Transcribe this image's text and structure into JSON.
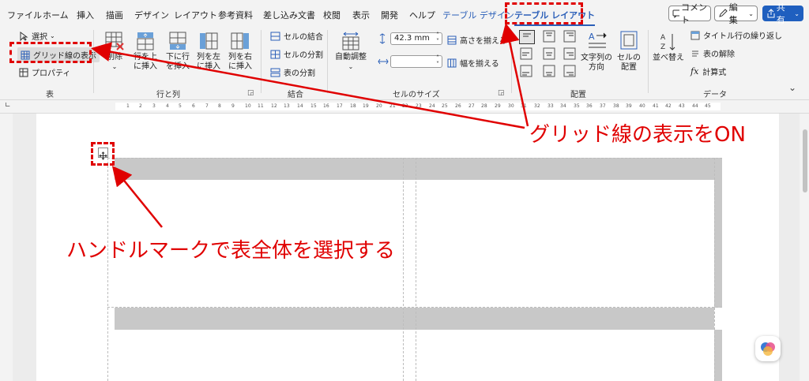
{
  "tabs": [
    "ファイル",
    "ホーム",
    "挿入",
    "描画",
    "デザイン",
    "レイアウト",
    "参考資料",
    "差し込み文書",
    "校閲",
    "表示",
    "開発",
    "ヘルプ",
    "テーブル デザイン",
    "テーブル レイアウト"
  ],
  "top_buttons": {
    "comment": "コメント",
    "edit": "編集",
    "share": "共有"
  },
  "ribbon": {
    "table_group": {
      "select": "選択",
      "gridlines": "グリッド線の表示",
      "properties": "プロパティ",
      "label": "表"
    },
    "rows_cols_group": {
      "delete": "削除",
      "insert_above": [
        "行を上",
        "に挿入"
      ],
      "insert_below": [
        "下に行",
        "を挿入"
      ],
      "insert_left": [
        "列を左",
        "に挿入"
      ],
      "insert_right": [
        "列を右",
        "に挿入"
      ],
      "label": "行と列"
    },
    "merge_group": {
      "merge_cells": "セルの結合",
      "split_cells": "セルの分割",
      "split_table": "表の分割",
      "label": "結合"
    },
    "cell_size_group": {
      "autofit": "自動調整",
      "height_value": "42.3 mm",
      "width_value": "",
      "distribute_rows": "高さを揃える",
      "distribute_cols": "幅を揃える",
      "label": "セルのサイズ"
    },
    "alignment_group": {
      "text_direction": [
        "文字列の",
        "方向"
      ],
      "cell_margins": [
        "セルの",
        "配置"
      ],
      "label": "配置"
    },
    "data_group": {
      "sort": "並べ替え",
      "repeat_header": "タイトル行の繰り返し",
      "convert_to_text": "表の解除",
      "formula": "計算式",
      "label": "データ"
    }
  },
  "ruler_numbers": [
    "1",
    "2",
    "3",
    "4",
    "5",
    "6",
    "7",
    "8",
    "9",
    "10",
    "11",
    "12",
    "13",
    "14",
    "15",
    "16",
    "17",
    "18",
    "19",
    "20",
    "21",
    "22",
    "23",
    "24",
    "25",
    "26",
    "27",
    "28",
    "29",
    "30",
    "31",
    "32",
    "33",
    "34",
    "35",
    "36",
    "37",
    "38",
    "39",
    "40",
    "41",
    "42",
    "43",
    "44",
    "45"
  ],
  "annotations": {
    "gridline_note": "グリッド線の表示をON",
    "handle_note": "ハンドルマークで表全体を選択する"
  },
  "colors": {
    "accent": "#2b5fb8",
    "annotation": "#e00000",
    "cell_shading": "#c8c8c8"
  }
}
